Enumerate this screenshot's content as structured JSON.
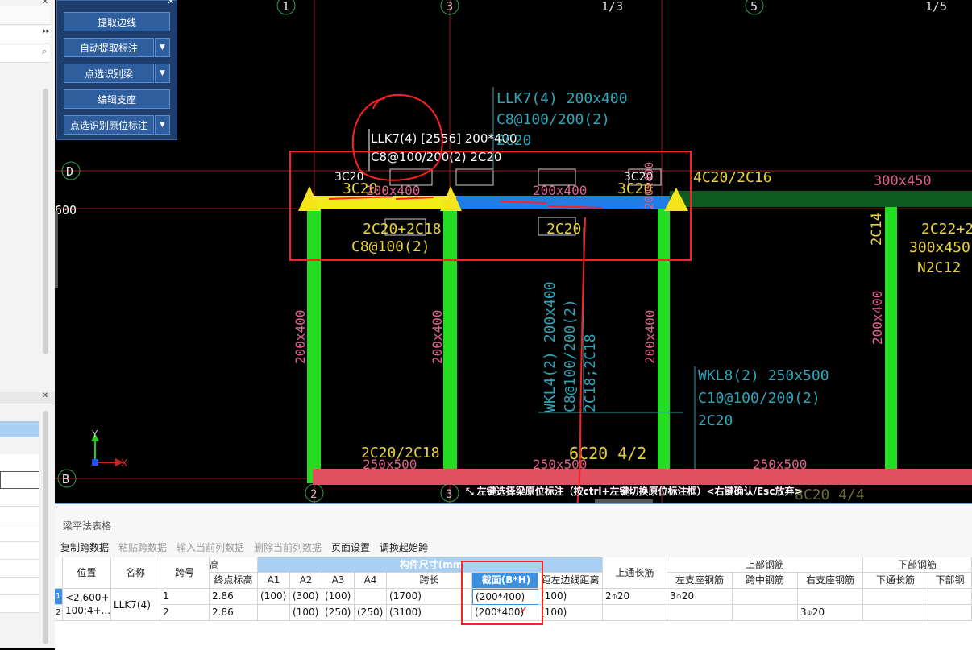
{
  "float_panel": {
    "buttons": [
      {
        "label": "提取边线",
        "has_dropdown": false
      },
      {
        "label": "自动提取标注",
        "has_dropdown": true
      },
      {
        "label": "点选识别梁",
        "has_dropdown": true
      },
      {
        "label": "编辑支座",
        "has_dropdown": false
      },
      {
        "label": "点选识别原位标注",
        "has_dropdown": true
      }
    ]
  },
  "cad": {
    "axis_top": [
      "1",
      "3",
      "1/3",
      "5",
      "1/5"
    ],
    "axis_bottom": [
      "2",
      "3"
    ],
    "axis_left": [
      "D",
      "B"
    ],
    "left_value": "600",
    "beam_annotation": {
      "line1": "LLK7(4) [2556] 200*400",
      "line2": "C8@100/200(2) 2C20"
    },
    "cyan_annotation": {
      "line1": "LLK7(4) 200x400",
      "line2": "C8@100/200(2)",
      "line3": "2C20"
    },
    "wkl8": {
      "line1": "WKL8(2) 250x500",
      "line2": "C10@100/200(2)",
      "line3": "2C20"
    },
    "wkl4": {
      "line1": "WKL4(2) 200x400",
      "line2": "C8@100/200(2)",
      "line3": "2C18;2C18"
    },
    "labels": {
      "c1": "3C20",
      "c2": "3C20",
      "c3": "3C20",
      "c4": "3C20",
      "s1": "200x400",
      "s2": "200x400",
      "s3": "200x400",
      "bot1": "2C20+2C18",
      "bot2": "C8@100(2)",
      "bot3": "2C20",
      "r1": "4C20/2C16",
      "r2": "300x450",
      "r3": "2C22+2",
      "r4": "300x450",
      "r5": "N2C12",
      "r6": "2C14",
      "col1": "200x400",
      "col2": "200x400",
      "col3": "200x400",
      "col4": "200x400",
      "bb1": "2C20/2C18",
      "bb2": "250x500",
      "bb3": "6C20 4/2",
      "bb4": "250x500",
      "bb5": "250x500",
      "bb6": "8C20 4/4"
    }
  },
  "ucs": {
    "x": "X",
    "y": "Y"
  },
  "status_hint": "左键选择梁原位标注（按ctrl+左键切换原位标注框）<右键确认/Esc放弃>",
  "table_panel": {
    "title": "梁平法表格",
    "toolbar": [
      {
        "label": "复制跨数据",
        "enabled": true
      },
      {
        "label": "粘贴跨数据",
        "enabled": false
      },
      {
        "label": "输入当前列数据",
        "enabled": false
      },
      {
        "label": "删除当前列数据",
        "enabled": false
      },
      {
        "label": "页面设置",
        "enabled": true
      },
      {
        "label": "调换起始跨",
        "enabled": true
      }
    ],
    "headers": {
      "position": "位置",
      "name": "名称",
      "span_no": "跨号",
      "elev_top": "高",
      "elev_end": "终点标高",
      "size_group": "构件尺寸(mm",
      "a1": "A1",
      "a2": "A2",
      "a3": "A3",
      "a4": "A4",
      "span_len": "跨长",
      "section": "截面(B*H)",
      "dist": "距左边线距离",
      "top_long": "上通长筋",
      "upper_group": "上部钢筋",
      "left_seat": "左支座钢筋",
      "mid": "跨中钢筋",
      "right_seat": "右支座钢筋",
      "lower_group": "下部钢筋",
      "bot_long": "下通长筋",
      "bot_more": "下部钢"
    },
    "position_value": "<2,600+\n100;4+...",
    "name_value": "LLK7(4)",
    "rows": [
      {
        "idx": "1",
        "span": "1",
        "elev": "2.86",
        "a1": "(100)",
        "a2": "(300)",
        "a3": "(100)",
        "a4": "",
        "len": "(1700)",
        "section": "(200*400)",
        "dist": "(100)",
        "top_long": "2⌽20",
        "left_seat": "3⌽20",
        "mid": "",
        "right_seat": ""
      },
      {
        "idx": "2",
        "span": "2",
        "elev": "2.86",
        "a1": "",
        "a2": "(100)",
        "a3": "(250)",
        "a4": "(250)",
        "len": "(3100)",
        "section": "(200*400)",
        "dist": "(100)",
        "top_long": "",
        "left_seat": "",
        "mid": "",
        "right_seat": "3⌽20"
      }
    ]
  },
  "colors": {
    "cad_bg": "#000000",
    "axis_red": "#c81e1e",
    "column_green": "#22dd22",
    "beam_blue": "#1e7de6",
    "beam_yellow": "#f2ec18",
    "annot_cyan": "#2fa6b8",
    "annot_yellow": "#e6d23a",
    "annot_pink": "#e0628a",
    "highlight_red": "#ff2020",
    "selected_blue": "#3d8fe0"
  }
}
